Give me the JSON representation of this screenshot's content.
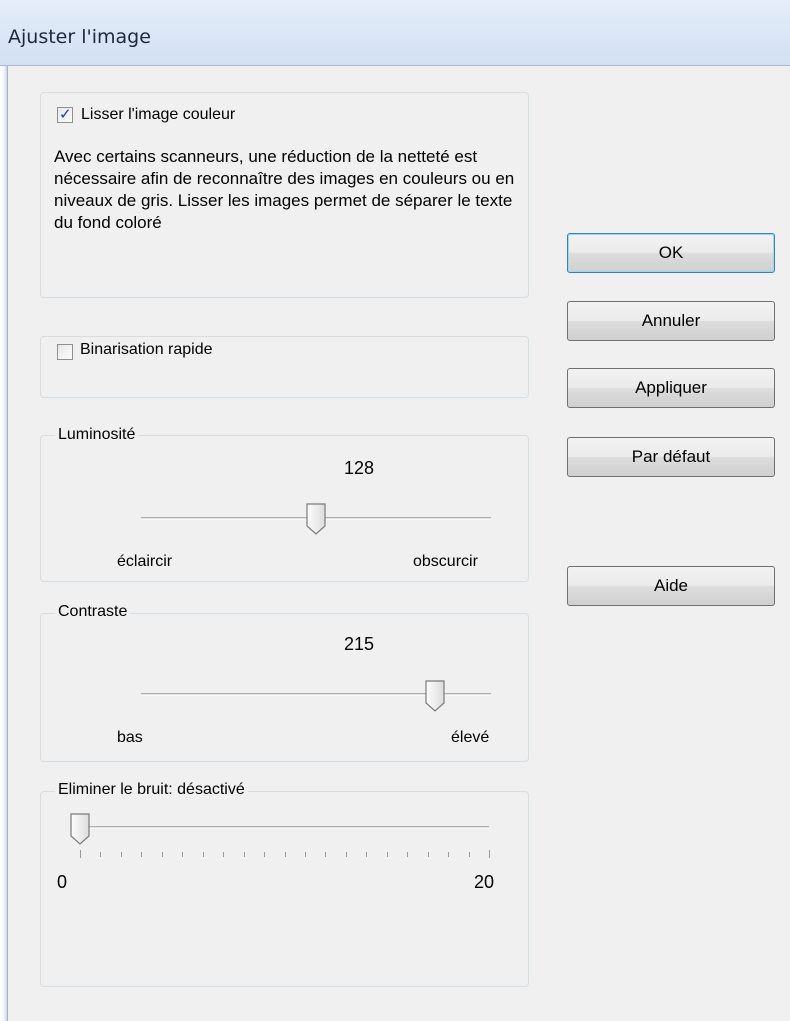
{
  "window": {
    "title": "Ajuster l'image"
  },
  "smooth": {
    "label": "Lisser l'image couleur",
    "checked": true,
    "description": "Avec certains scanneurs, une réduction de la netteté est nécessaire afin de reconnaître des images en couleurs ou en niveaux de gris. Lisser les images permet de séparer le texte du fond coloré"
  },
  "binarization": {
    "label": "Binarisation rapide",
    "checked": false
  },
  "brightness": {
    "legend": "Luminosité",
    "value": "128",
    "min_label": "éclaircir",
    "max_label": "obscurcir",
    "level": 0.5
  },
  "contrast": {
    "legend": "Contraste",
    "value": "215",
    "min_label": "bas",
    "max_label": "élevé",
    "level": 0.84
  },
  "noise": {
    "legend": "Eliminer le bruit: désactivé",
    "min": "0",
    "max": "20",
    "level": 0
  },
  "buttons": {
    "ok": "OK",
    "cancel": "Annuler",
    "apply": "Appliquer",
    "default": "Par défaut",
    "help": "Aide"
  }
}
